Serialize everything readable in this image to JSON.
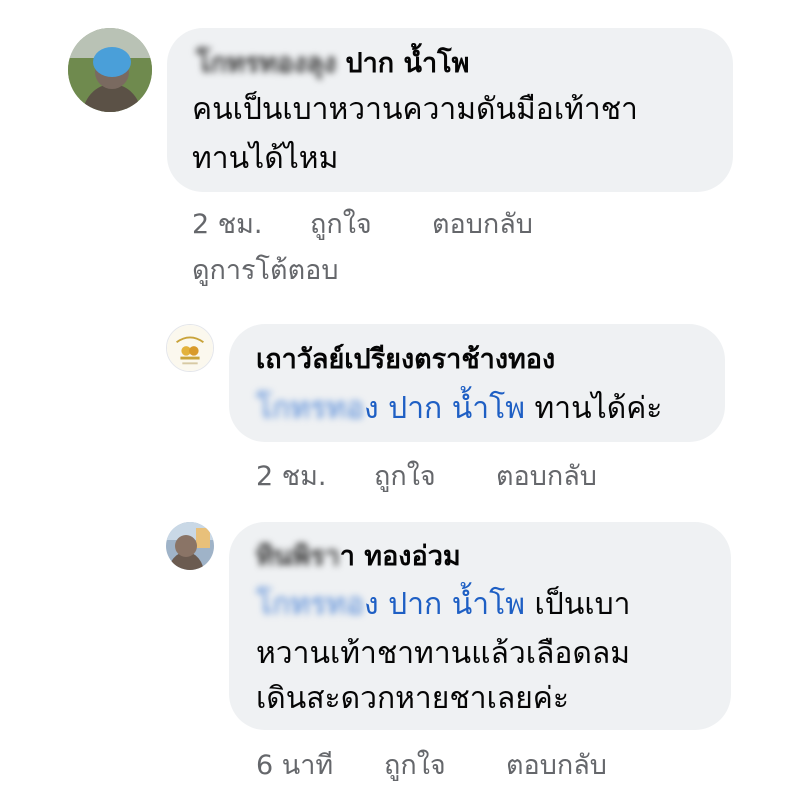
{
  "comments": [
    {
      "author_hidden": "โกทรทองลุง",
      "author_visible": "ปาก น้ำโพ",
      "lines": [
        "คนเป็นเบาหวานความดันมือเท้าชา",
        "ทานได้ไหม"
      ],
      "time": "2 ชม.",
      "like": "ถูกใจ",
      "reply": "ตอบกลับ",
      "view_replies": "ดูการโต้ตอบ"
    },
    {
      "author": "เถาวัลย์เปรียงตราช้างทอง",
      "mention_hidden": "โกทรทอ",
      "mention_visible": "ง ปาก น้ำโพ",
      "line1_rest": " ทานได้ค่ะ",
      "time": "2 ชม.",
      "like": "ถูกใจ",
      "reply": "ตอบกลับ"
    },
    {
      "author_hidden": "ทินพิรา",
      "author_visible": "า ทองอ่วม",
      "mention_hidden": "โกทรทอ",
      "mention_visible": "ง ปาก น้ำโพ",
      "line1_rest": " เป็นเบา",
      "lines": [
        "หวานเท้าชาทานแล้วเลือดลม",
        "เดินสะดวกหายชาเลยค่ะ"
      ],
      "time": "6 นาที",
      "like": "ถูกใจ",
      "reply": "ตอบกลับ"
    }
  ],
  "colors": {
    "bubble": "#eff1f3",
    "mention": "#1e5fc4",
    "meta": "#65676b"
  }
}
